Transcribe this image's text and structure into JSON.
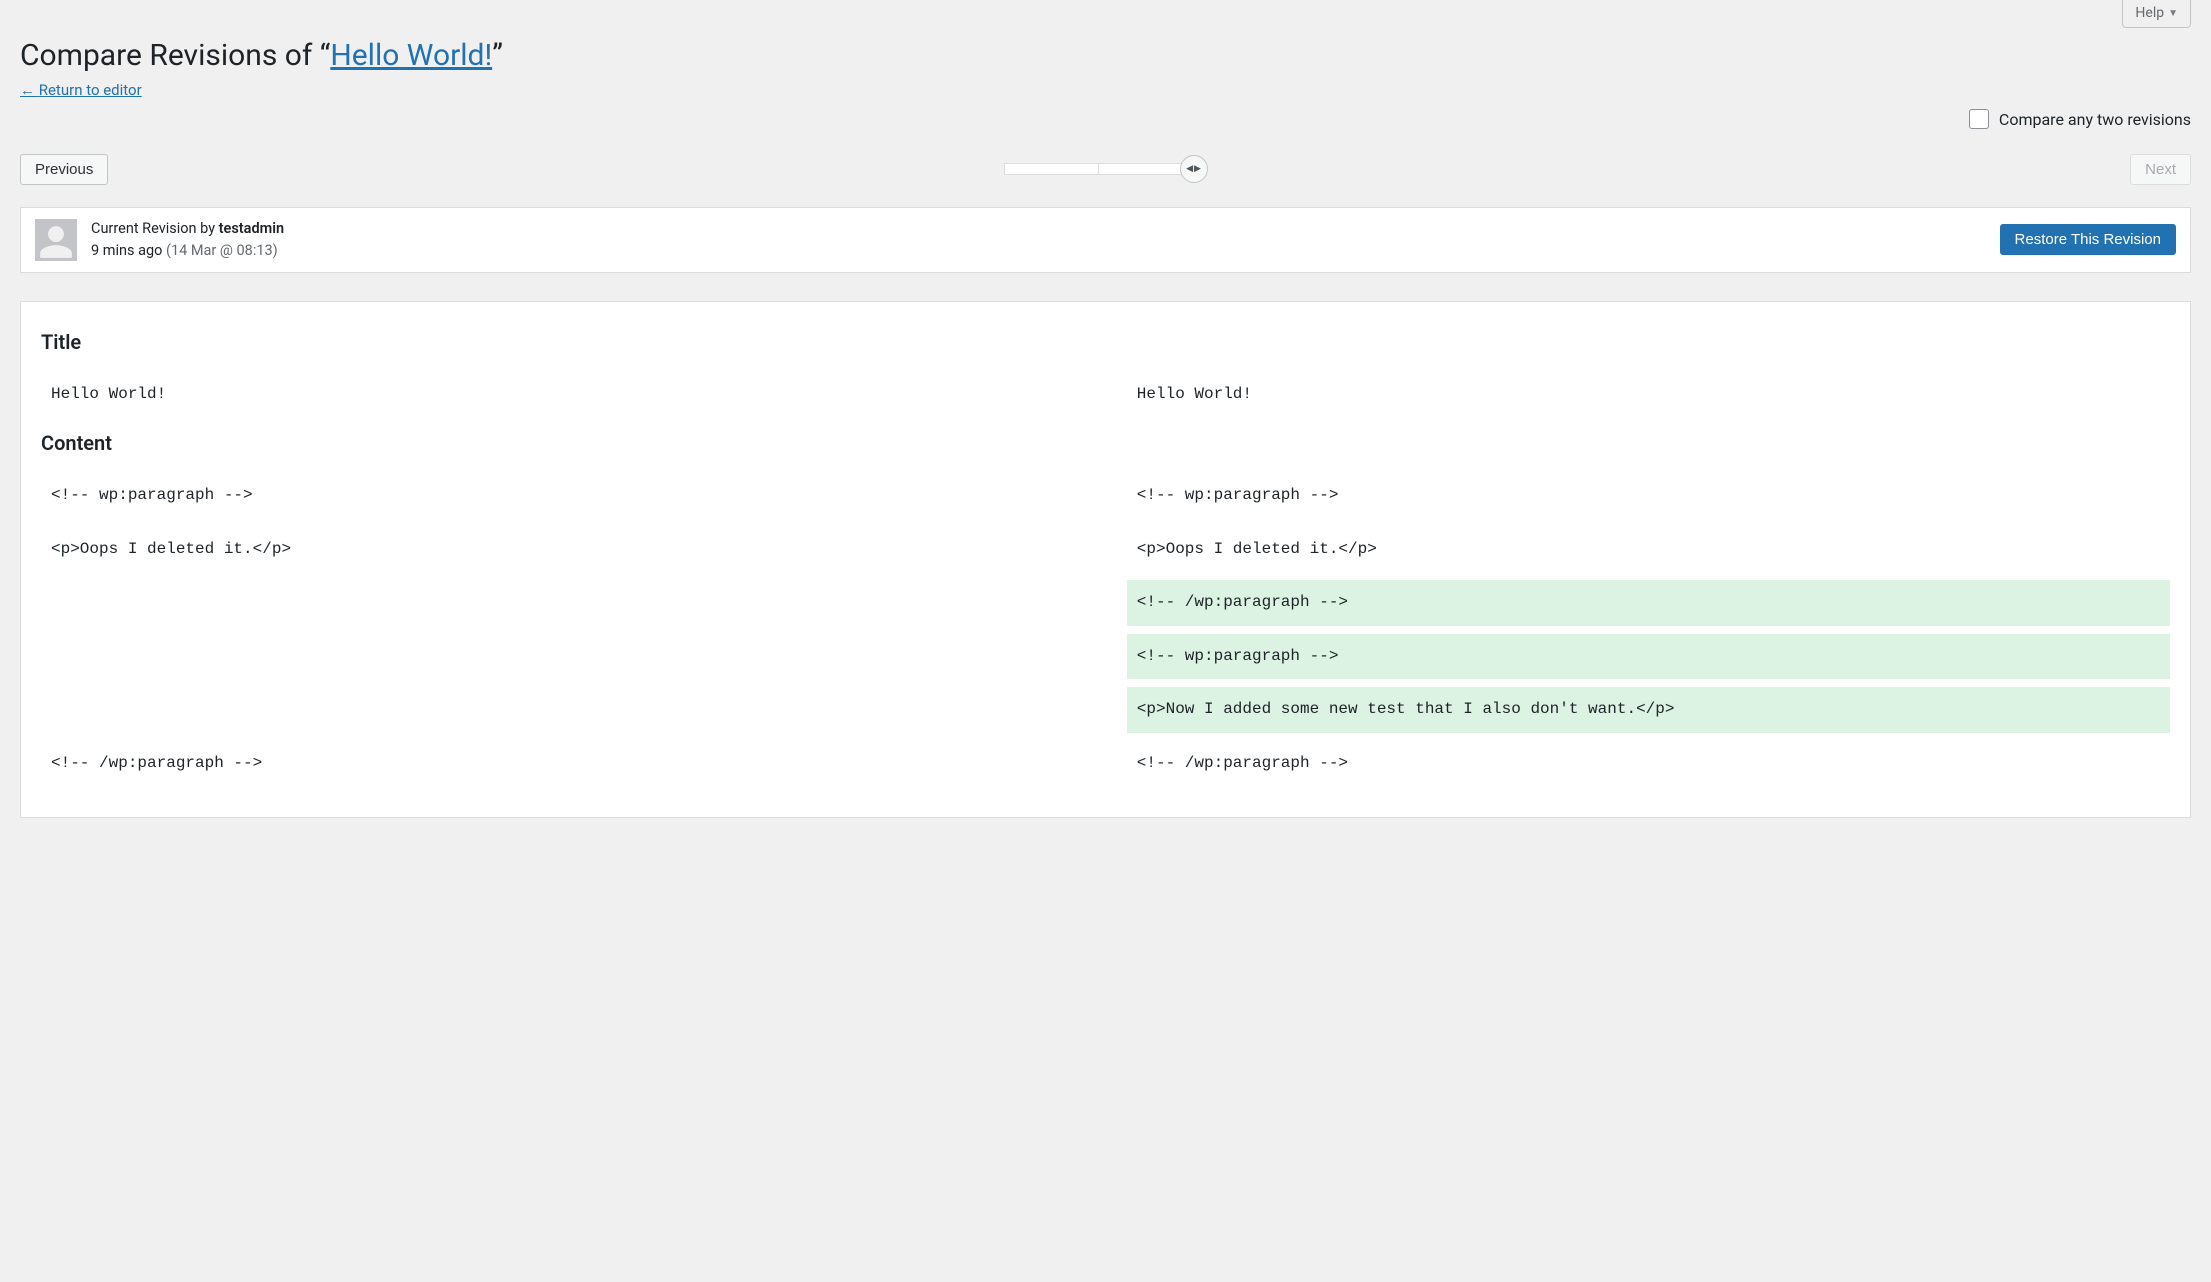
{
  "help": {
    "label": "Help"
  },
  "header": {
    "prefix": "Compare Revisions of “",
    "post_title": "Hello World!",
    "suffix": "”",
    "return_arrow": "←",
    "return_label": "Return to editor"
  },
  "compare_toggle": {
    "label": "Compare any two revisions"
  },
  "nav": {
    "prev": "Previous",
    "next": "Next"
  },
  "meta": {
    "by_prefix": "Current Revision by",
    "author": "testadmin",
    "ago": "9 mins ago",
    "absolute": "(14 Mar @ 08:13)",
    "restore": "Restore This Revision"
  },
  "sections": {
    "title_label": "Title",
    "content_label": "Content"
  },
  "diff": {
    "title": {
      "left": "Hello World!",
      "right": "Hello World!"
    },
    "content_rows": [
      {
        "left": "<!-- wp:paragraph -->",
        "right": "<!-- wp:paragraph -->",
        "left_class": "",
        "right_class": ""
      },
      {
        "spacer": true
      },
      {
        "left": "<p>Oops I deleted it.</p>",
        "right": "<p>Oops I deleted it.</p>",
        "left_class": "",
        "right_class": ""
      },
      {
        "spacer": true
      },
      {
        "left": "",
        "right": "<!-- /wp:paragraph -->",
        "left_class": "",
        "right_class": "added"
      },
      {
        "spacer": true
      },
      {
        "left": "",
        "right": "<!-- wp:paragraph -->",
        "left_class": "",
        "right_class": "added"
      },
      {
        "spacer": true
      },
      {
        "left": "",
        "right": "<p>Now I added some new test that I also don't want.</p>",
        "left_class": "",
        "right_class": "added"
      },
      {
        "spacer": true
      },
      {
        "left": "<!-- /wp:paragraph -->",
        "right": "<!-- /wp:paragraph -->",
        "left_class": "",
        "right_class": ""
      }
    ]
  }
}
